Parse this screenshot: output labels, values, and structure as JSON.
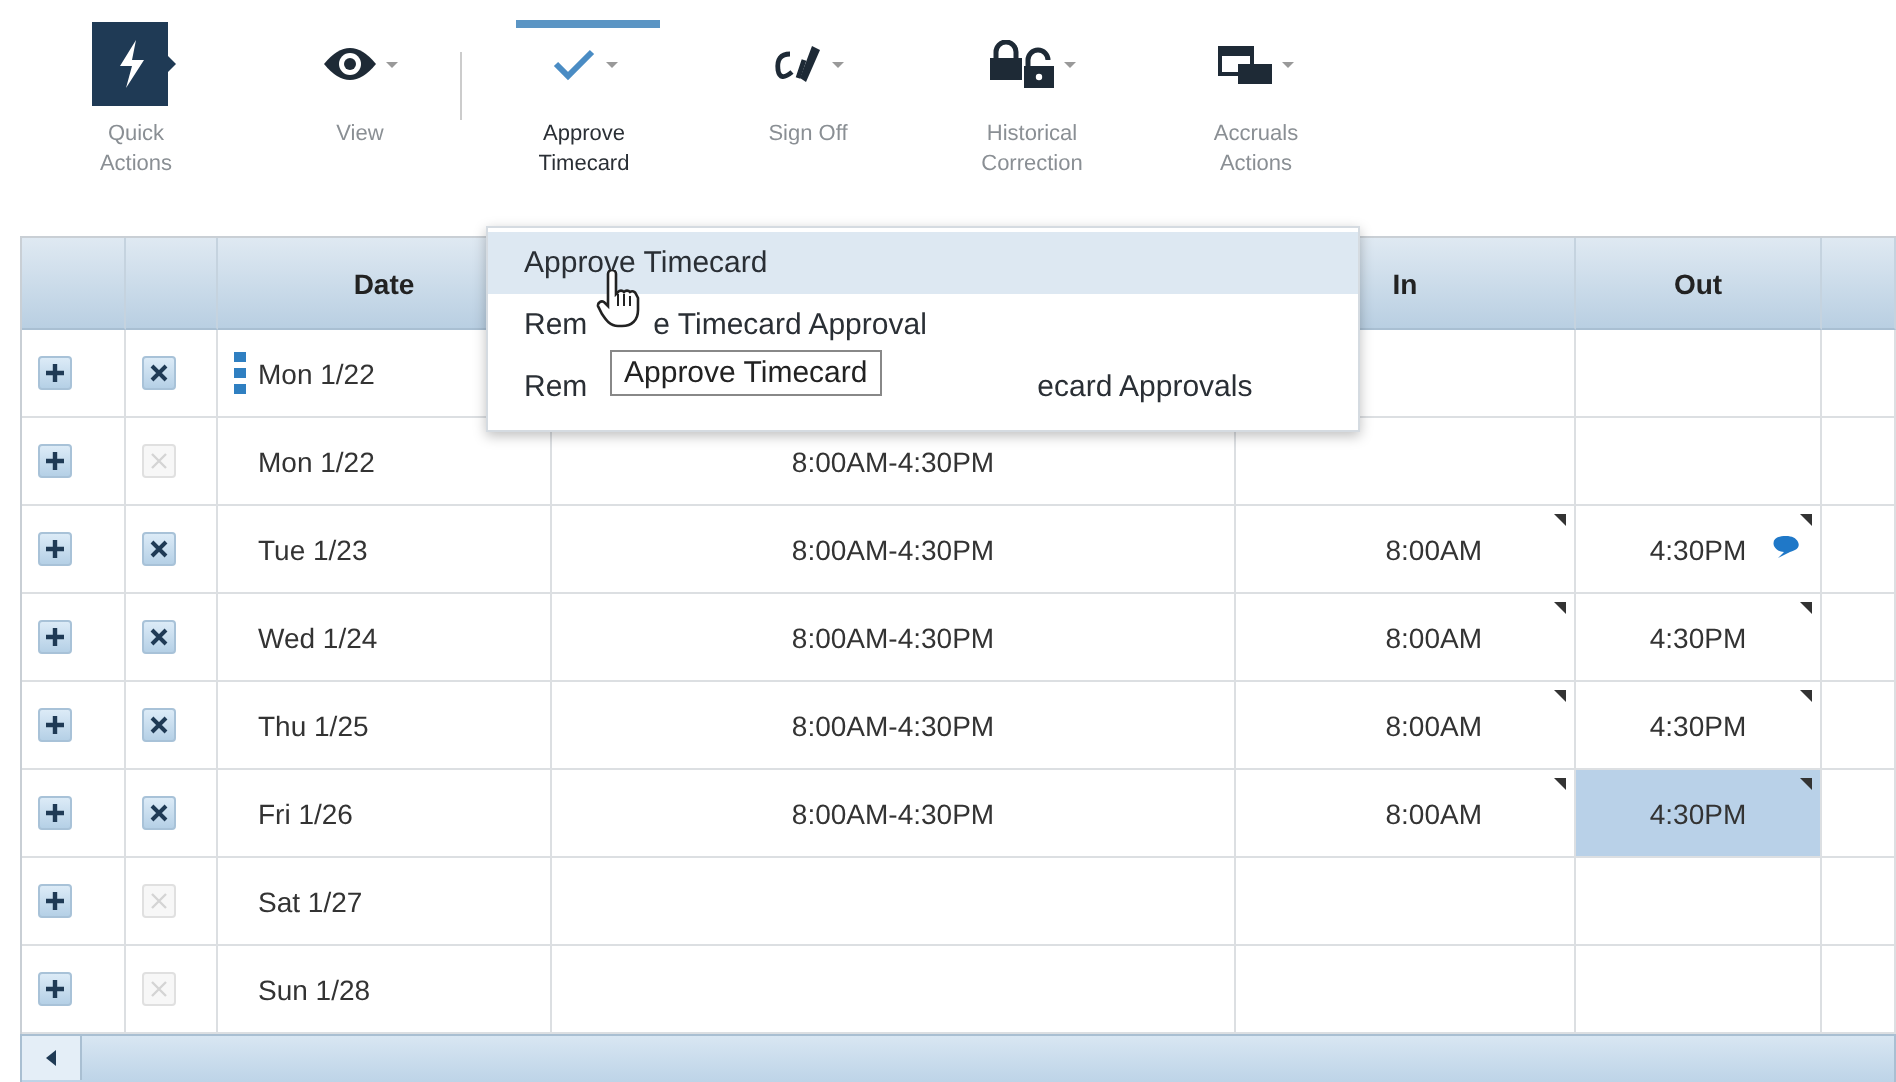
{
  "toolbar": {
    "items": [
      {
        "kind": "quick",
        "label": "Quick Actions",
        "selected": false,
        "caret": false
      },
      {
        "kind": "view",
        "label": "View",
        "selected": false,
        "caret": true
      },
      {
        "kind": "approve",
        "label": "Approve Timecard",
        "selected": true,
        "caret": true
      },
      {
        "kind": "signoff",
        "label": "Sign Off",
        "selected": false,
        "caret": true
      },
      {
        "kind": "historical",
        "label": "Historical Correction",
        "selected": false,
        "caret": true
      },
      {
        "kind": "accruals",
        "label": "Accruals Actions",
        "selected": false,
        "caret": true
      }
    ]
  },
  "table": {
    "columns": [
      "Date",
      "In",
      "Out"
    ],
    "rows": [
      {
        "marker": true,
        "delete_enabled": true,
        "date": "Mon 1/22"
      },
      {
        "marker": false,
        "delete_enabled": false,
        "date": "Mon 1/22",
        "schedule": "8:00AM-4:30PM"
      },
      {
        "marker": false,
        "delete_enabled": true,
        "date": "Tue 1/23",
        "schedule": "8:00AM-4:30PM",
        "in": {
          "text": "8:00AM",
          "flagged": true
        },
        "out": {
          "text": "4:30PM",
          "flagged": true,
          "comment": true,
          "selected": false
        }
      },
      {
        "marker": false,
        "delete_enabled": true,
        "date": "Wed 1/24",
        "schedule": "8:00AM-4:30PM",
        "in": {
          "text": "8:00AM",
          "flagged": true
        },
        "out": {
          "text": "4:30PM",
          "flagged": true,
          "comment": false,
          "selected": false
        }
      },
      {
        "marker": false,
        "delete_enabled": true,
        "date": "Thu 1/25",
        "schedule": "8:00AM-4:30PM",
        "in": {
          "text": "8:00AM",
          "flagged": true
        },
        "out": {
          "text": "4:30PM",
          "flagged": true,
          "comment": false,
          "selected": false
        }
      },
      {
        "marker": false,
        "delete_enabled": true,
        "date": "Fri 1/26",
        "schedule": "8:00AM-4:30PM",
        "in": {
          "text": "8:00AM",
          "flagged": true
        },
        "out": {
          "text": "4:30PM",
          "flagged": true,
          "comment": false,
          "selected": true
        }
      },
      {
        "marker": false,
        "delete_enabled": false,
        "date": "Sat 1/27"
      },
      {
        "marker": false,
        "delete_enabled": false,
        "date": "Sun 1/28"
      }
    ]
  },
  "menu": {
    "items": [
      {
        "parts": [
          "Approve Timecard"
        ],
        "selected": true
      },
      {
        "parts": [
          "Rem",
          "e Timecard Approval"
        ],
        "selected": false
      },
      {
        "parts": [
          "Rem",
          "ecard Approvals"
        ],
        "selected": false
      }
    ]
  },
  "tooltip": {
    "text": "Approve Timecard"
  }
}
